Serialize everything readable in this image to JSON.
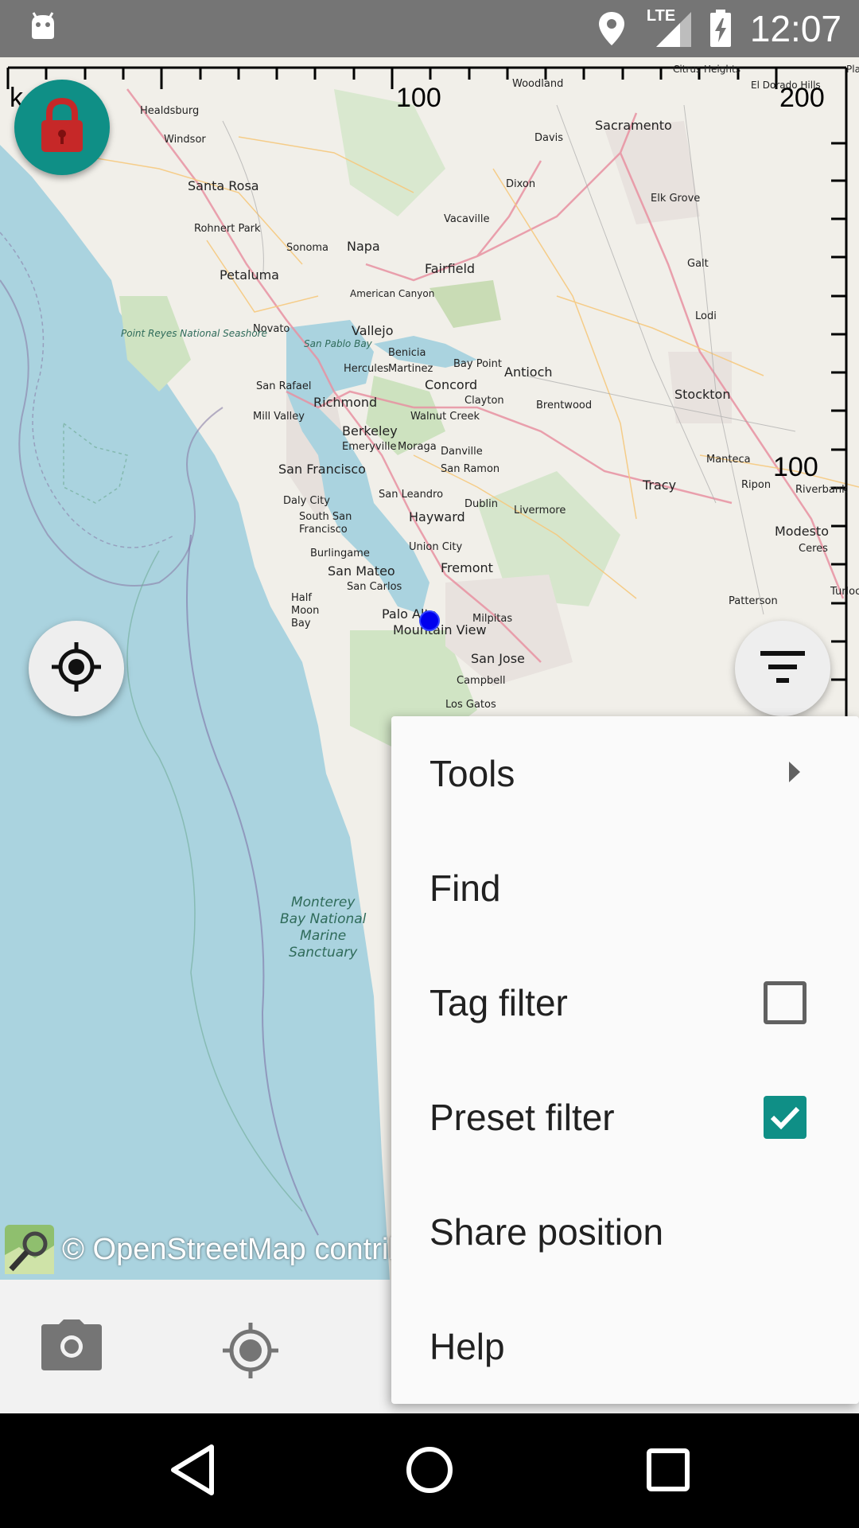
{
  "status_bar": {
    "time": "12:07",
    "network_label": "LTE",
    "icons": [
      "android-icon",
      "location-pin-icon",
      "signal-icon",
      "battery-charging-icon"
    ]
  },
  "map": {
    "scale_labels": {
      "top_unit": "k",
      "top_100": "100",
      "top_200": "200",
      "right_100": "100"
    },
    "attribution": "© OpenStreetMap contributors",
    "place_labels": [
      "Healdsburg",
      "Windsor",
      "Santa Rosa",
      "Rohnert Park",
      "Sonoma",
      "Napa",
      "Petaluma",
      "Novato",
      "Point Reyes National Seashore",
      "Fairfield",
      "Vacaville",
      "Dixon",
      "Davis",
      "Woodland",
      "Sacramento",
      "Elk Grove",
      "Galt",
      "Lodi",
      "Stockton",
      "Manteca",
      "Tracy",
      "Modesto",
      "Ceres",
      "Ripon",
      "Riverbank",
      "Patterson",
      "Turlock",
      "American Canyon",
      "Vallejo",
      "San Pablo Bay",
      "Benicia",
      "Martinez",
      "Hercules",
      "Bay Point",
      "Antioch",
      "Concord",
      "Clayton",
      "Brentwood",
      "San Rafael",
      "Richmond",
      "Mill Valley",
      "Walnut Creek",
      "Berkeley",
      "Emeryville",
      "Moraga",
      "Danville",
      "San Ramon",
      "San Francisco",
      "Daly City",
      "South San Francisco",
      "San Leandro",
      "Dublin",
      "Livermore",
      "Hayward",
      "Union City",
      "Burlingame",
      "San Mateo",
      "Fremont",
      "San Carlos",
      "Half Moon Bay",
      "Palo Alto",
      "Milpitas",
      "Mountain View",
      "San Jose",
      "Campbell",
      "Los Gatos",
      "Citrus Heights",
      "El Dorado Hills",
      "Placerville"
    ],
    "sea_label": [
      "Monterey",
      "Bay National",
      "Marine",
      "Sanctuary"
    ],
    "colors": {
      "water": "#aad3df",
      "land": "#f1efe9",
      "accent": "#0f8f86",
      "gps_dot": "#0000ee"
    }
  },
  "buttons": {
    "lock": "lock-icon",
    "locate": "my-location-icon",
    "filter": "filter-icon",
    "camera": "camera-icon",
    "gps": "gps-icon"
  },
  "menu": {
    "items": [
      {
        "label": "Tools",
        "trail": "submenu-arrow"
      },
      {
        "label": "Find",
        "trail": ""
      },
      {
        "label": "Tag filter",
        "trail": "checkbox",
        "checked": false
      },
      {
        "label": "Preset filter",
        "trail": "checkbox",
        "checked": true
      },
      {
        "label": "Share position",
        "trail": ""
      },
      {
        "label": "Help",
        "trail": ""
      }
    ]
  },
  "nav_bar": {
    "buttons": [
      "back",
      "home",
      "recents"
    ]
  }
}
